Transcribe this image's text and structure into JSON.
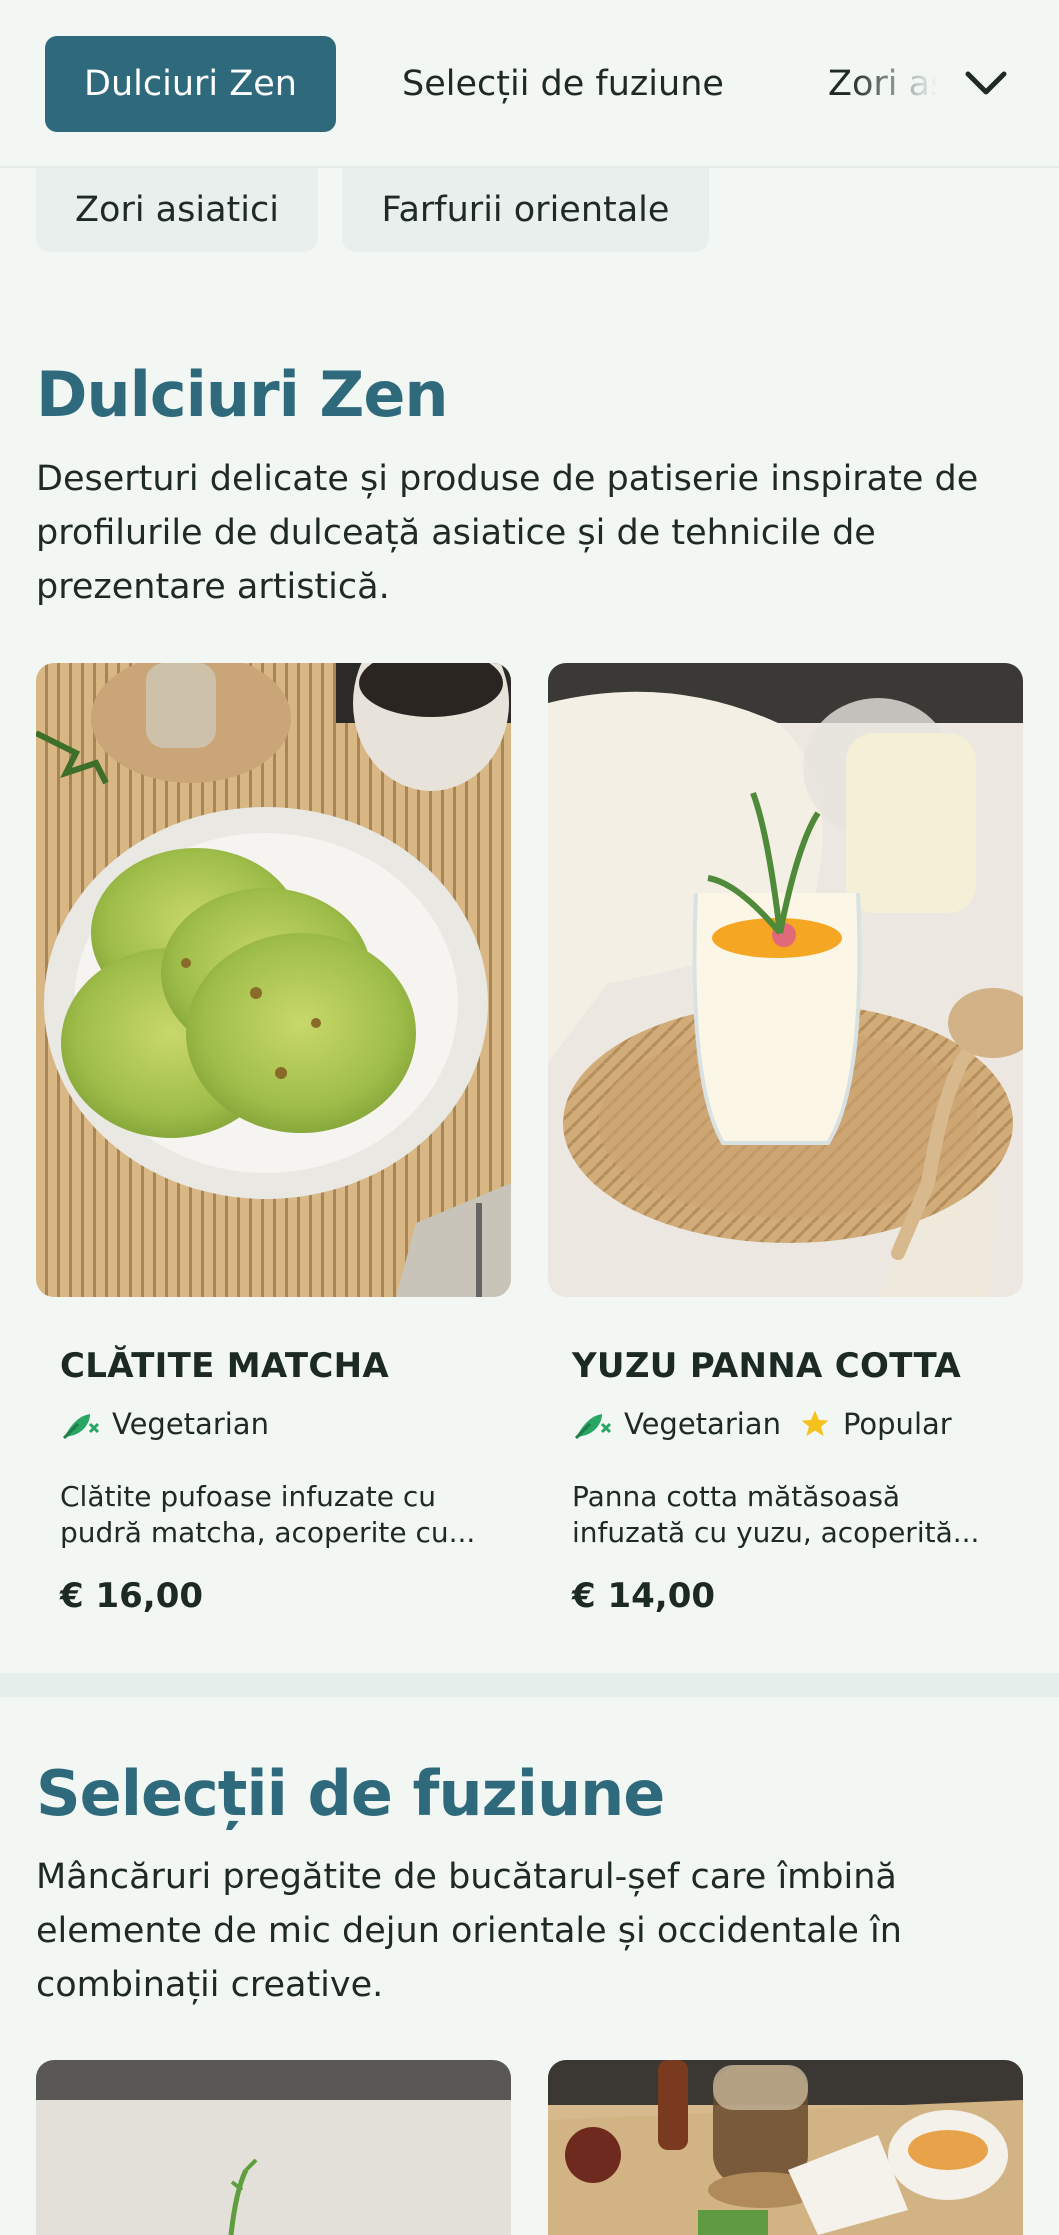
{
  "categories": {
    "active": "Dulciuri Zen",
    "second": "Selecții de fuziune",
    "third_partial": "Zori asiatici",
    "row2": [
      "Zori asiatici",
      "Farfurii orientale"
    ]
  },
  "sections": [
    {
      "title": "Dulciuri Zen",
      "description": "Deserturi delicate și produse de patiserie inspirate de profilurile de dulceață asiatice și de tehnicile de prezentare artistică.",
      "items": [
        {
          "name": "CLĂTITE MATCHA",
          "tags": [
            {
              "icon": "vegetarian-icon",
              "label": "Vegetarian"
            }
          ],
          "description": "Clătite pufoase infuzate cu pudră matcha, acoperite cu...",
          "price": "€ 16,00"
        },
        {
          "name": "YUZU PANNA COTTA",
          "tags": [
            {
              "icon": "vegetarian-icon",
              "label": "Vegetarian"
            },
            {
              "icon": "star-icon",
              "label": "Popular"
            }
          ],
          "description": "Panna cotta mătăsoasă infuzată cu yuzu, acoperită...",
          "price": "€ 14,00"
        }
      ]
    },
    {
      "title": "Selecții de fuziune",
      "description": "Mâncăruri pregătite de bucătarul-șef care îmbină elemente de mic dejun orientale și occidentale în combinații creative."
    }
  ],
  "colors": {
    "accent": "#2e6a7c",
    "background": "#f2f7f4",
    "vegetarian": "#2aa664",
    "star": "#f5c21b"
  }
}
